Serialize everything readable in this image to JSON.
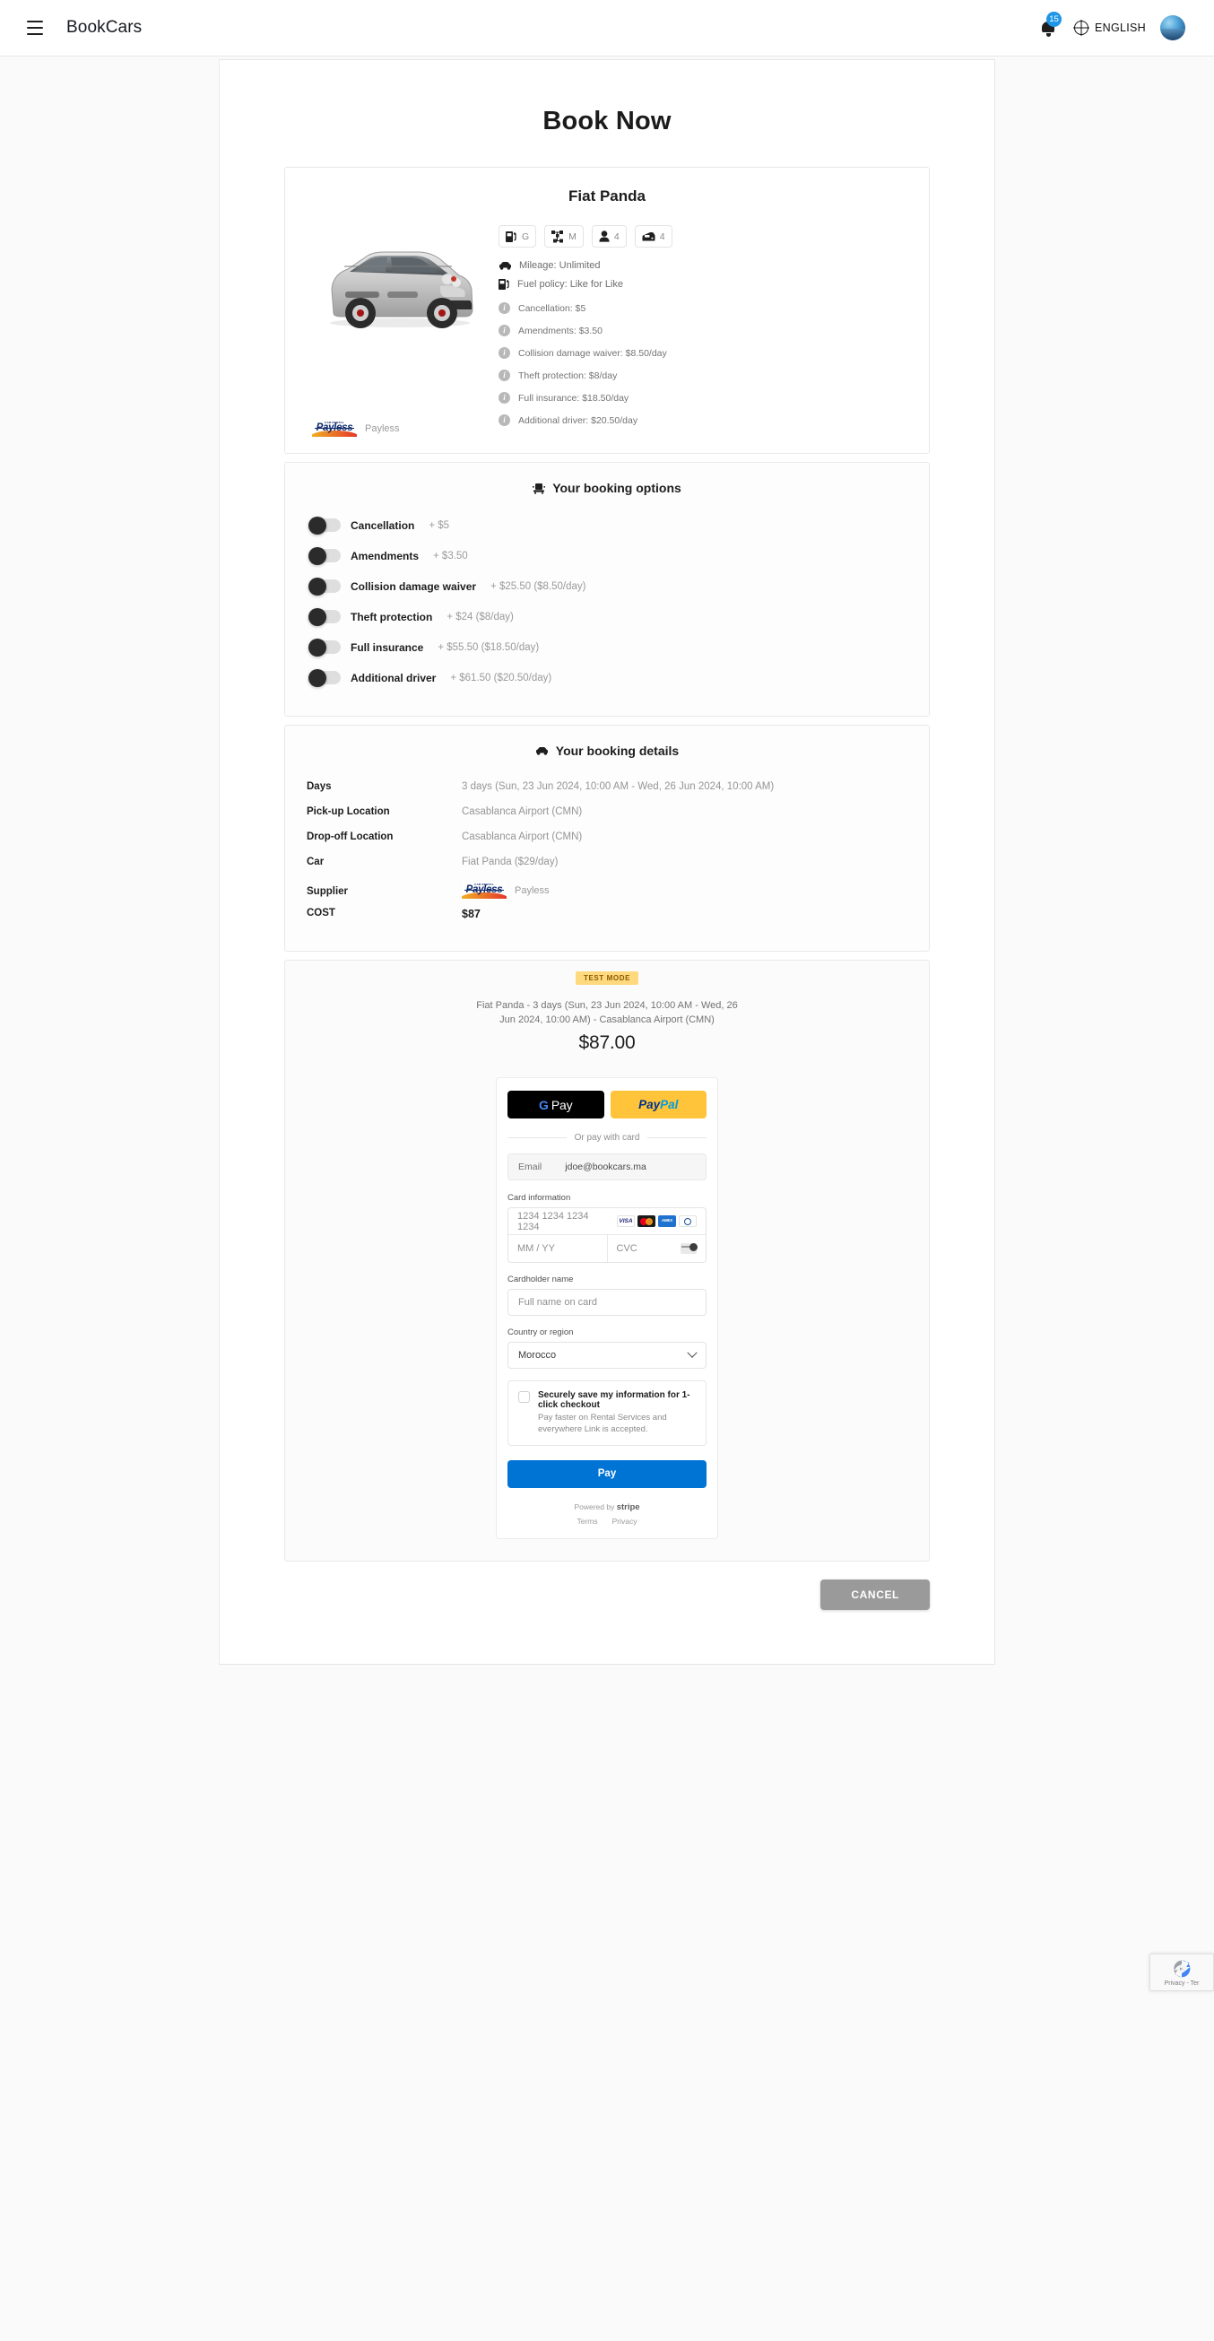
{
  "header": {
    "brand": "BookCars",
    "notifications_count": "15",
    "language": "ENGLISH",
    "menu_icon": "hamburger-menu-icon",
    "bell_icon": "notification-bell-icon",
    "globe_icon": "globe-icon",
    "avatar_icon": "user-avatar"
  },
  "page": {
    "title": "Book Now"
  },
  "car": {
    "name": "Fiat Panda",
    "chips": [
      {
        "icon": "fuel-pump-icon",
        "value": "G"
      },
      {
        "icon": "gearbox-icon",
        "value": "M"
      },
      {
        "icon": "person-icon",
        "value": "4"
      },
      {
        "icon": "car-door-icon",
        "value": "4"
      }
    ],
    "mileage": "Mileage: Unlimited",
    "fuel_policy": "Fuel policy: Like for Like",
    "extras": [
      "Cancellation: $5",
      "Amendments: $3.50",
      "Collision damage waiver: $8.50/day",
      "Theft protection: $8/day",
      "Full insurance: $18.50/day",
      "Additional driver: $20.50/day"
    ],
    "supplier_name": "Payless",
    "supplier_logo_text": "Payless",
    "supplier_logo_tagline": "CAR RENTAL"
  },
  "options": {
    "title": "Your booking options",
    "title_icon": "seat-icon",
    "items": [
      {
        "label": "Cancellation",
        "price": "+ $5",
        "on": false
      },
      {
        "label": "Amendments",
        "price": "+ $3.50",
        "on": false
      },
      {
        "label": "Collision damage waiver",
        "price": "+ $25.50 ($8.50/day)",
        "on": false
      },
      {
        "label": "Theft protection",
        "price": "+ $24 ($8/day)",
        "on": false
      },
      {
        "label": "Full insurance",
        "price": "+ $55.50 ($18.50/day)",
        "on": false
      },
      {
        "label": "Additional driver",
        "price": "+ $61.50 ($20.50/day)",
        "on": false
      }
    ]
  },
  "details": {
    "title": "Your booking details",
    "title_icon": "car-icon",
    "days_label": "Days",
    "days_value": "3 days (Sun, 23 Jun 2024, 10:00 AM - Wed, 26 Jun 2024, 10:00 AM)",
    "pickup_label": "Pick-up Location",
    "pickup_value": "Casablanca Airport (CMN)",
    "dropoff_label": "Drop-off Location",
    "dropoff_value": "Casablanca Airport (CMN)",
    "car_label": "Car",
    "car_value": "Fiat Panda ($29/day)",
    "supplier_label": "Supplier",
    "supplier_value": "Payless",
    "cost_label": "COST",
    "cost_value": "$87"
  },
  "payment": {
    "test_mode": "TEST MODE",
    "order_description": "Fiat Panda - 3 days (Sun, 23 Jun 2024, 10:00 AM - Wed, 26 Jun 2024, 10:00 AM) - Casablanca Airport (CMN)",
    "order_total": "$87.00",
    "gpay_label": "Pay",
    "paypal_a": "Pay",
    "paypal_b": "Pal",
    "or_divider": "Or pay with card",
    "email_label": "Email",
    "email_value": "jdoe@bookcars.ma",
    "card_info_label": "Card information",
    "card_number_placeholder": "1234 1234 1234 1234",
    "expiry_placeholder": "MM / YY",
    "cvc_placeholder": "CVC",
    "card_brands": [
      "visa-icon",
      "mastercard-icon",
      "amex-icon",
      "discover-icon"
    ],
    "visa_text": "VISA",
    "amex_text": "AMEX",
    "cardholder_label": "Cardholder name",
    "cardholder_placeholder": "Full name on card",
    "country_label": "Country or region",
    "country_value": "Morocco",
    "link_title": "Securely save my information for 1-click checkout",
    "link_sub": "Pay faster on Rental Services and everywhere Link is accepted.",
    "pay_button": "Pay",
    "powered_by": "Powered by ",
    "powered_brand": "stripe",
    "terms": "Terms",
    "privacy": "Privacy"
  },
  "footer": {
    "cancel_label": "CANCEL"
  },
  "recaptcha": {
    "text": "Privacy - Ter",
    "icon": "recaptcha-icon"
  },
  "colors": {
    "accent_blue": "#0074d4",
    "badge_blue": "#1e96e8",
    "paypal_yellow": "#ffc439",
    "test_mode_yellow": "#ffd97d",
    "cancel_grey": "#9a9a9a"
  }
}
